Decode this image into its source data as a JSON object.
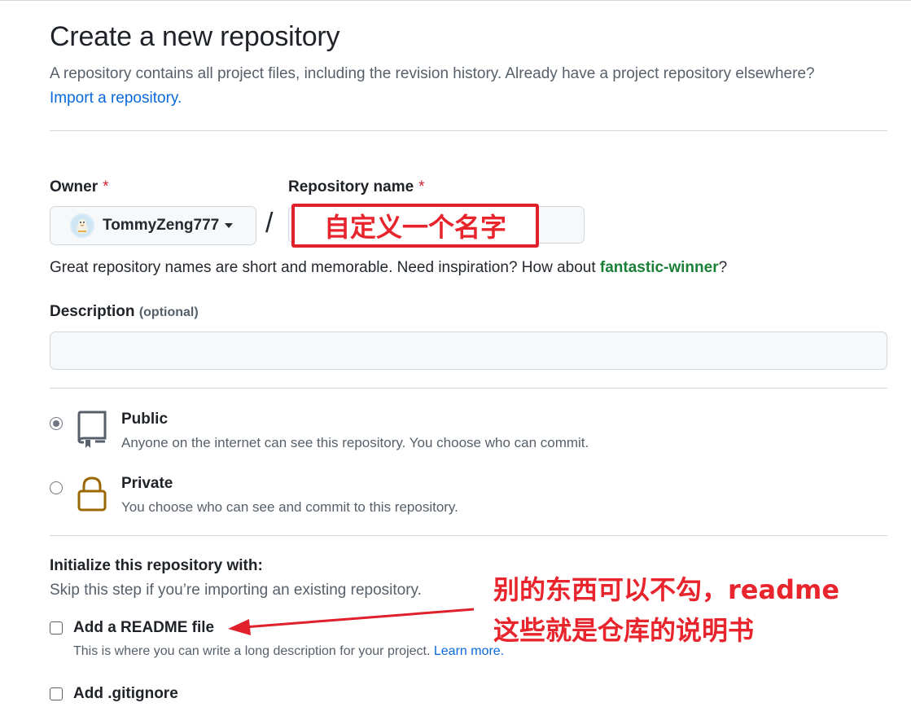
{
  "header": {
    "title": "Create a new repository",
    "intro": "A repository contains all project files, including the revision history. Already have a project repository elsewhere?",
    "import_link": "Import a repository."
  },
  "owner": {
    "label": "Owner",
    "required_mark": "*",
    "value": "TommyZeng777"
  },
  "repo_name": {
    "label": "Repository name",
    "required_mark": "*",
    "separator": "/",
    "value": ""
  },
  "annotation_name": "自定义一个名字",
  "name_hint": {
    "prefix": "Great repository names are short and memorable. Need inspiration? How about ",
    "suggestion": "fantastic-winner",
    "suffix": "?"
  },
  "description": {
    "label": "Description",
    "optional": "(optional)",
    "value": ""
  },
  "visibility": {
    "public": {
      "title": "Public",
      "desc": "Anyone on the internet can see this repository. You choose who can commit.",
      "checked": true,
      "icon": "repo-icon"
    },
    "private": {
      "title": "Private",
      "desc": "You choose who can see and commit to this repository.",
      "checked": false,
      "icon": "lock-icon"
    }
  },
  "init": {
    "title": "Initialize this repository with:",
    "subtitle": "Skip this step if you’re importing an existing repository.",
    "readme_label": "Add a README file",
    "readme_desc": "This is where you can write a long description for your project.",
    "learn_more": "Learn more.",
    "gitignore_label": "Add .gitignore"
  },
  "annotation_note": {
    "line1": "别的东西可以不勾，readme",
    "line2": "这些就是仓库的说明书"
  },
  "colors": {
    "link": "#0969da",
    "suggestion": "#1a7f37",
    "required": "#cf222e",
    "annotation": "#e8242c",
    "lock": "#9a6700"
  }
}
